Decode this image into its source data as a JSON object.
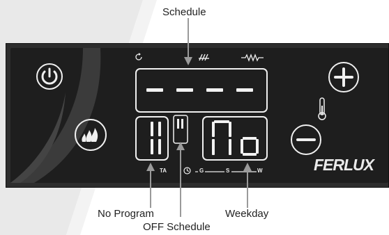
{
  "callouts": {
    "schedule": "Schedule",
    "no_program": "No Program",
    "off_schedule": "OFF Schedule",
    "weekday": "Weekday"
  },
  "display": {
    "top_row": "- - - -",
    "left_digits": "1",
    "mid_digit": "1",
    "right_text": "No"
  },
  "labels": {
    "ta": "TA",
    "g": "G",
    "s": "S",
    "w": "W"
  },
  "brand": "FERLUX",
  "colors": {
    "panel": "#2d2d2d",
    "display_bg": "#1e1e1e",
    "segment": "#f2f2f2",
    "callout_line": "#9a9a9a"
  },
  "icons": [
    "power-icon",
    "flame-icon",
    "plus-icon",
    "minus-icon",
    "thermometer-icon",
    "cycle-icon",
    "heater-icon",
    "resistance-icon",
    "clock-icon"
  ]
}
